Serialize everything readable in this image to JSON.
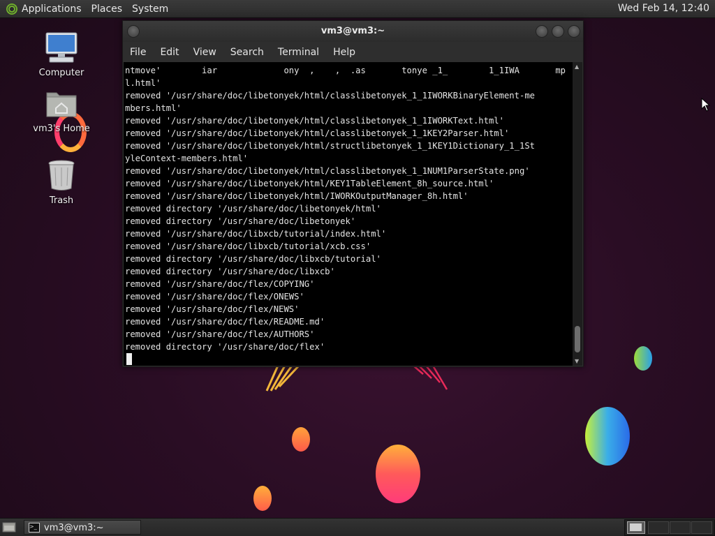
{
  "top_panel": {
    "menu": [
      "Applications",
      "Places",
      "System"
    ],
    "clock": "Wed Feb 14, 12:40"
  },
  "desktop": {
    "icons": [
      {
        "label": "Computer",
        "icon": "computer-icon"
      },
      {
        "label": "vm3's Home",
        "icon": "home-folder-icon"
      },
      {
        "label": "Trash",
        "icon": "trash-icon"
      }
    ]
  },
  "terminal": {
    "title": "vm3@vm3:~",
    "menu": [
      "File",
      "Edit",
      "View",
      "Search",
      "Terminal",
      "Help"
    ],
    "lines": [
      "ntmove'        iar             ony  ,    ,  .as       tonye _1_        1_1IWA       mp",
      "l.html'",
      "removed '/usr/share/doc/libetonyek/html/classlibetonyek_1_1IWORKBinaryElement-me",
      "mbers.html'",
      "removed '/usr/share/doc/libetonyek/html/classlibetonyek_1_1IWORKText.html'",
      "removed '/usr/share/doc/libetonyek/html/classlibetonyek_1_1KEY2Parser.html'",
      "removed '/usr/share/doc/libetonyek/html/structlibetonyek_1_1KEY1Dictionary_1_1St",
      "yleContext-members.html'",
      "removed '/usr/share/doc/libetonyek/html/classlibetonyek_1_1NUM1ParserState.png'",
      "removed '/usr/share/doc/libetonyek/html/KEY1TableElement_8h_source.html'",
      "removed '/usr/share/doc/libetonyek/html/IWORKOutputManager_8h.html'",
      "removed directory '/usr/share/doc/libetonyek/html'",
      "removed directory '/usr/share/doc/libetonyek'",
      "removed '/usr/share/doc/libxcb/tutorial/index.html'",
      "removed '/usr/share/doc/libxcb/tutorial/xcb.css'",
      "removed directory '/usr/share/doc/libxcb/tutorial'",
      "removed directory '/usr/share/doc/libxcb'",
      "removed '/usr/share/doc/flex/COPYING'",
      "removed '/usr/share/doc/flex/ONEWS'",
      "removed '/usr/share/doc/flex/NEWS'",
      "removed '/usr/share/doc/flex/README.md'",
      "removed '/usr/share/doc/flex/AUTHORS'",
      "removed directory '/usr/share/doc/flex'"
    ]
  },
  "taskbar": {
    "window_label": "vm3@vm3:~"
  }
}
